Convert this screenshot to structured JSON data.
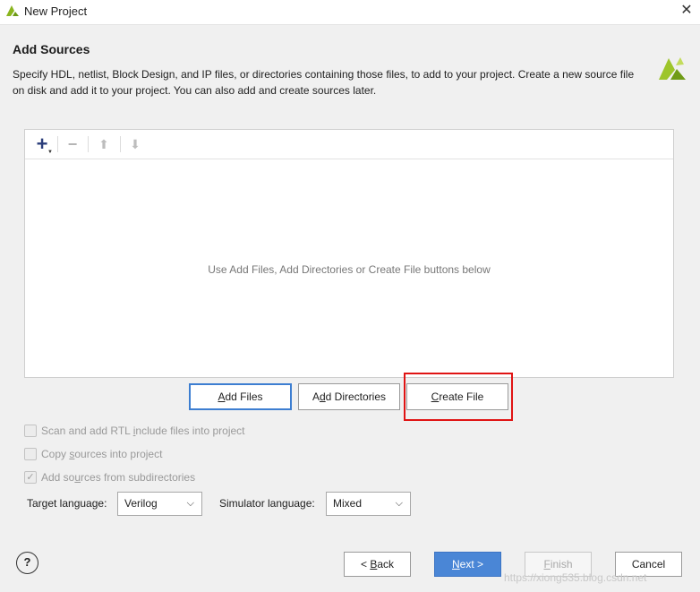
{
  "window": {
    "title": "New Project",
    "close_glyph": "✕"
  },
  "page": {
    "heading": "Add Sources",
    "description": "Specify HDL, netlist, Block Design, and IP files, or directories containing those files, to add to your project. Create a new source file on disk and add it to your project. You can also add and create sources later."
  },
  "toolbar": {
    "add_glyph": "+",
    "remove_glyph": "−",
    "up_glyph": "⬆",
    "down_glyph": "⬇"
  },
  "file_list": {
    "empty_message": "Use Add Files, Add Directories or Create File buttons below"
  },
  "add_buttons": {
    "add_files": {
      "mnemonic": "A",
      "rest": "dd Files"
    },
    "add_directories": {
      "before": "A",
      "mnemonic": "d",
      "rest": "d Directories"
    },
    "create_file": {
      "before": "",
      "mnemonic": "C",
      "rest": "reate File"
    }
  },
  "options": {
    "scan_rtl": {
      "before": "Scan and add RTL ",
      "mnemonic": "i",
      "rest": "nclude files into project",
      "checked": false
    },
    "copy_sources": {
      "before": "Copy ",
      "mnemonic": "s",
      "rest": "ources into project",
      "checked": false
    },
    "add_subdirs": {
      "before": "Add so",
      "mnemonic": "u",
      "rest": "rces from subdirectories",
      "checked": true,
      "check_glyph": "✓"
    }
  },
  "target_language": {
    "label": "Target language:",
    "value": "Verilog"
  },
  "simulator_language": {
    "label": "Simulator language:",
    "value": "Mixed"
  },
  "footer": {
    "help_glyph": "?",
    "back": {
      "before": "< ",
      "mnemonic": "B",
      "rest": "ack"
    },
    "next": {
      "mnemonic": "N",
      "rest": "ext >"
    },
    "finish": {
      "mnemonic": "F",
      "rest": "inish"
    },
    "cancel": "Cancel",
    "watermark": "https://xiong535.blog.csdn.net"
  },
  "colors": {
    "accent": "#4a86d6",
    "highlight_box": "#e01414",
    "brand_green": "#8ab51f"
  },
  "icons": {
    "app_logo": "xilinx-logo-icon",
    "chevron": "chevron-down-icon"
  }
}
